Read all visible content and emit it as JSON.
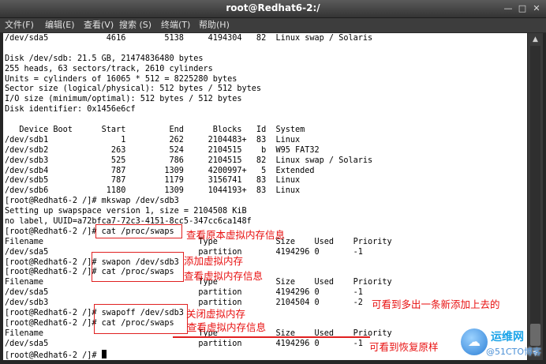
{
  "window": {
    "title": "root@Redhat6-2:/",
    "minimize_icon": "minimize-icon",
    "maximize_icon": "maximize-icon",
    "close_icon": "close-icon"
  },
  "menu": [
    "文件(F)",
    "编辑(E)",
    "查看(V)",
    "搜索 (S)",
    "终端(T)",
    "帮助(H)"
  ],
  "terminal": {
    "lines": [
      "/dev/sda5            4616        5138     4194304   82  Linux swap / Solaris",
      "",
      "Disk /dev/sdb: 21.5 GB, 21474836480 bytes",
      "255 heads, 63 sectors/track, 2610 cylinders",
      "Units = cylinders of 16065 * 512 = 8225280 bytes",
      "Sector size (logical/physical): 512 bytes / 512 bytes",
      "I/O size (minimum/optimal): 512 bytes / 512 bytes",
      "Disk identifier: 0x1456e6cf",
      "",
      "   Device Boot      Start         End      Blocks   Id  System",
      "/dev/sdb1               1         262     2104483+  83  Linux",
      "/dev/sdb2             263         524     2104515    b  W95 FAT32",
      "/dev/sdb3             525         786     2104515   82  Linux swap / Solaris",
      "/dev/sdb4             787        1309     4200997+   5  Extended",
      "/dev/sdb5             787        1179     3156741   83  Linux",
      "/dev/sdb6            1180        1309     1044193+  83  Linux",
      "[root@Redhat6-2 /]# mkswap /dev/sdb3",
      "Setting up swapspace version 1, size = 2104508 KiB",
      "no label, UUID=a72bfca7-72c3-4151-8cc5-347cc6ca148f",
      "[root@Redhat6-2 /]# cat /proc/swaps",
      "Filename                                Type            Size    Used    Priority",
      "/dev/sda5                               partition       4194296 0       -1",
      "[root@Redhat6-2 /]# swapon /dev/sdb3",
      "[root@Redhat6-2 /]# cat /proc/swaps",
      "Filename                                Type            Size    Used    Priority",
      "/dev/sda5                               partition       4194296 0       -1",
      "/dev/sdb3                               partition       2104504 0       -2",
      "[root@Redhat6-2 /]# swapoff /dev/sdb3",
      "[root@Redhat6-2 /]# cat /proc/swaps",
      "Filename                                Type            Size    Used    Priority",
      "/dev/sda5                               partition       4194296 0       -1",
      "[root@Redhat6-2 /]# "
    ]
  },
  "annotations": {
    "view_original": "查看原本虚拟内存信息",
    "add_virtual": "添加虚拟内存",
    "view_virtual_1": "查看虚拟内存信息",
    "see_new_entry": "可看到多出一条新添加上去的",
    "close_virtual": "关闭虚拟内存",
    "view_virtual_2": "查看虚拟内存信息",
    "see_restored": "可看到恢复原样"
  },
  "watermark": {
    "title": "运维网",
    "subtitle": "@51CTO博客",
    "icon": "cloud-logo-icon"
  },
  "colors": {
    "annotation": "#e81010",
    "terminal_bg": "#ffffff",
    "chrome": "#343434"
  }
}
